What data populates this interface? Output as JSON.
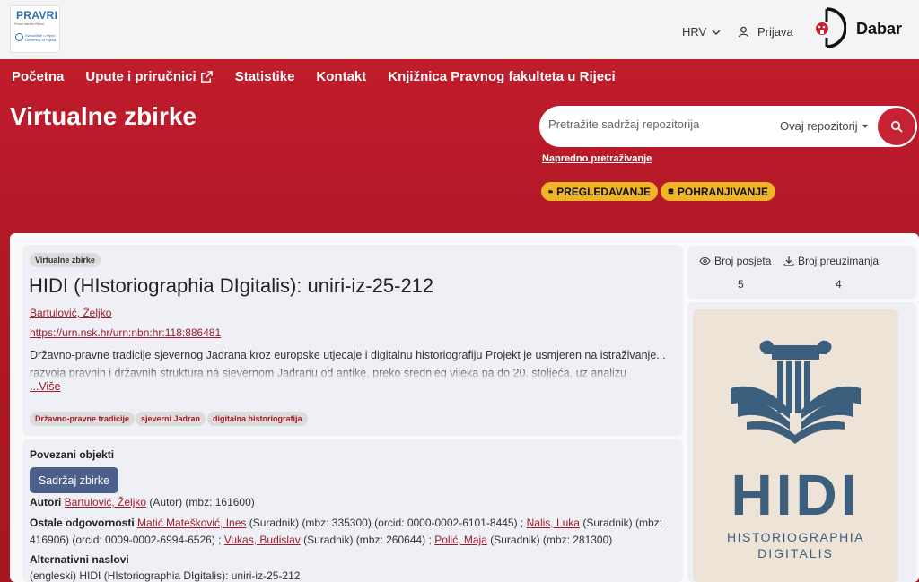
{
  "header": {
    "logo": {
      "name": "PRAVRI",
      "subtitle": "Pravni fakultet Rijeka",
      "university": "Sveučilište u Rijeci University of Rijeka"
    },
    "language": "HRV",
    "login": "Prijava",
    "brand": "Dabar"
  },
  "nav": {
    "items": [
      "Početna",
      "Upute i priručnici",
      "Statistike",
      "Kontakt",
      "Knjižnica Pravnog fakulteta u Rijeci"
    ]
  },
  "page_title": "Virtualne zbirke",
  "search": {
    "placeholder": "Pretražite sadržaj repozitorija",
    "scope": "Ovaj repozitorij",
    "advanced": "Napredno pretraživanje"
  },
  "actions": {
    "browse": "PREGLEDAVANJE",
    "deposit": "POHRANJIVANJE"
  },
  "record": {
    "type_tag": "Virtualne zbirke",
    "title": "HIDI (HIstoriographia DIgitalis): uniri-iz-25-212",
    "author": "Bartulović, Željko",
    "urn": "https://urn.nsk.hr/urn:nbn:hr:118:886481",
    "abstract_line1": "Državno-pravne tradicije sjevernog Jadrana kroz europske utjecaje i digitalnu historiografiju Projekt je usmjeren na istraživanje...",
    "abstract_line2": "razvoja pravnih i državnih struktura na sjevernom Jadranu od antike, preko srednjeg vijeka pa do 20. stoljeća, uz analizu",
    "more": "...Više",
    "keywords": [
      "Državno-pravne tradicije",
      "sjeverni Jadran",
      "digitalna historiografija"
    ]
  },
  "linked": {
    "heading": "Povezani objekti",
    "button": "Sadržaj zbirke",
    "authors_label": "Autori",
    "authors_link": "Bartulović, Željko",
    "authors_rest": "(Autor) (mbz: 161600)",
    "other_label": "Ostale odgovornosti",
    "c1": "Matić Matešković, Ines",
    "c1_rest": "(Suradnik) (mbz: 335300) (orcid: 0000-0002-6101-8445) ;",
    "c2": "Nalis, Luka",
    "c2_rest": "(Suradnik) (mbz:",
    "line3_start": "416906) (orcid: 0009-0002-6994-6526) ;",
    "c3": "Vukas, Budislav",
    "c3_rest": "(Suradnik) (mbz: 260644) ;",
    "c4": "Polić, Maja",
    "c4_rest": "(Suradnik) (mbz: 281300)",
    "alt_label": "Alternativni naslovi",
    "alt_value": "(engleski) HIDI (HIstoriographia DIgitalis): uniri-iz-25-212"
  },
  "stats": {
    "visits_label": "Broj posjeta",
    "visits": "5",
    "downloads_label": "Broj preuzimanja",
    "downloads": "4"
  },
  "thumbnail": {
    "big": "HIDI",
    "line1": "HISTORIOGRAPHIA",
    "line2": "DIGITALIS"
  },
  "colors": {
    "accent": "#b01826",
    "link": "#a11a2a",
    "pill": "#f0b429",
    "button": "#4b5f8a",
    "logo_blue": "#3c5f7d"
  }
}
